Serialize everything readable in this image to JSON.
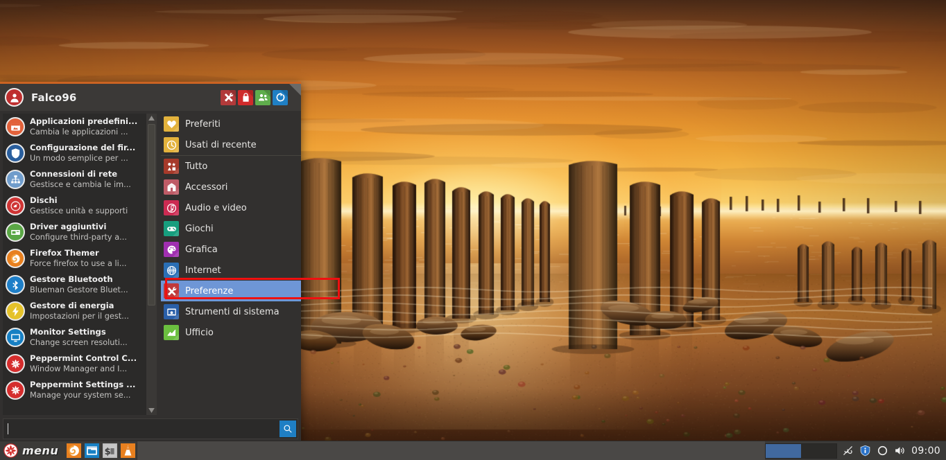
{
  "desktop": {
    "name": "desktop-wallpaper"
  },
  "menu": {
    "user": "Falco96",
    "avatar_icon": "user-avatar-icon",
    "header_buttons": [
      {
        "name": "settings-manager-button",
        "icon": "tools-icon",
        "color": "#b23a3a"
      },
      {
        "name": "lock-screen-button",
        "icon": "lock-icon",
        "color": "#cf2b2b"
      },
      {
        "name": "switch-user-button",
        "icon": "users-icon",
        "color": "#5fad4c"
      },
      {
        "name": "logout-button",
        "icon": "logout-icon",
        "color": "#1f7fc4"
      }
    ],
    "apps": [
      {
        "name": "Applicazioni predefini...",
        "desc": "Cambia le applicazioni ...",
        "icon": "default-apps-icon",
        "color": "#e2613a"
      },
      {
        "name": "Configurazione del fir...",
        "desc": "Un modo semplice per ...",
        "icon": "firewall-shield-icon",
        "color": "#2a5f9e"
      },
      {
        "name": "Connessioni di rete",
        "desc": "Gestisce e cambia le im...",
        "icon": "network-icon",
        "color": "#6f9ccb"
      },
      {
        "name": "Dischi",
        "desc": "Gestisce unità e supporti",
        "icon": "disks-icon",
        "color": "#cf3434"
      },
      {
        "name": "Driver aggiuntivi",
        "desc": "Configure third-party a...",
        "icon": "drivers-icon",
        "color": "#5aa745"
      },
      {
        "name": "Firefox Themer",
        "desc": "Force firefox to use a li...",
        "icon": "firefox-icon",
        "color": "#e8801f"
      },
      {
        "name": "Gestore Bluetooth",
        "desc": "Blueman Gestore Bluet...",
        "icon": "bluetooth-icon",
        "color": "#1e7fc8"
      },
      {
        "name": "Gestore di energia",
        "desc": "Impostazioni per il gest...",
        "icon": "power-icon",
        "color": "#e5c22a"
      },
      {
        "name": "Monitor Settings",
        "desc": "Change screen resoluti...",
        "icon": "monitor-icon",
        "color": "#1780c4"
      },
      {
        "name": "Peppermint Control C...",
        "desc": "Window Manager and I...",
        "icon": "peppermint-icon",
        "color": "#d52d2d"
      },
      {
        "name": "Peppermint Settings ...",
        "desc": "Manage your system se...",
        "icon": "peppermint-icon",
        "color": "#d52d2d"
      }
    ],
    "categories": [
      {
        "label": "Preferiti",
        "icon": "heart-icon",
        "color": "#e3b23c",
        "selected": false,
        "separator": false
      },
      {
        "label": "Usati di recente",
        "icon": "clock-icon",
        "color": "#e3b23c",
        "selected": false,
        "separator": true
      },
      {
        "label": "Tutto",
        "icon": "all-apps-icon",
        "color": "#a63a2a",
        "selected": false,
        "separator": false
      },
      {
        "label": "Accessori",
        "icon": "accessories-icon",
        "color": "#bf5b66",
        "selected": false,
        "separator": false
      },
      {
        "label": "Audio e video",
        "icon": "multimedia-icon",
        "color": "#cc2b52",
        "selected": false,
        "separator": false
      },
      {
        "label": "Giochi",
        "icon": "games-icon",
        "color": "#179e7e",
        "selected": false,
        "separator": false
      },
      {
        "label": "Grafica",
        "icon": "graphics-icon",
        "color": "#a02fb0",
        "selected": false,
        "separator": false
      },
      {
        "label": "Internet",
        "icon": "globe-icon",
        "color": "#2a6fb5",
        "selected": false,
        "separator": false
      },
      {
        "label": "Preferenze",
        "icon": "preferences-icon",
        "color": "#c0393b",
        "selected": true,
        "separator": false
      },
      {
        "label": "Strumenti di sistema",
        "icon": "system-tools-icon",
        "color": "#2a5fa8",
        "selected": false,
        "separator": false
      },
      {
        "label": "Ufficio",
        "icon": "office-icon",
        "color": "#6bbf3f",
        "selected": false,
        "separator": false
      }
    ],
    "search": {
      "value": "",
      "placeholder": "",
      "button_icon": "search-icon"
    },
    "highlight_color": "#ef1010",
    "selection_color": "#6e96d6"
  },
  "taskbar": {
    "menu_label": "menu",
    "menu_icon": "peppermint-icon",
    "launchers": [
      {
        "name": "launcher-firefox",
        "icon": "firefox-icon"
      },
      {
        "name": "launcher-file-manager",
        "icon": "file-manager-icon"
      },
      {
        "name": "launcher-terminal",
        "icon": "terminal-icon"
      },
      {
        "name": "launcher-vlc",
        "icon": "vlc-cone-icon"
      }
    ],
    "workspaces": [
      {
        "name": "workspace-1",
        "active": true
      },
      {
        "name": "workspace-2",
        "active": false
      }
    ],
    "tray": [
      {
        "name": "network-disconnected-icon",
        "icon": "network-offline-icon"
      },
      {
        "name": "updates-icon",
        "icon": "info-shield-icon"
      },
      {
        "name": "disk-activity-icon",
        "icon": "circle-icon"
      },
      {
        "name": "volume-icon",
        "icon": "speaker-icon"
      }
    ],
    "clock": "09:00"
  }
}
